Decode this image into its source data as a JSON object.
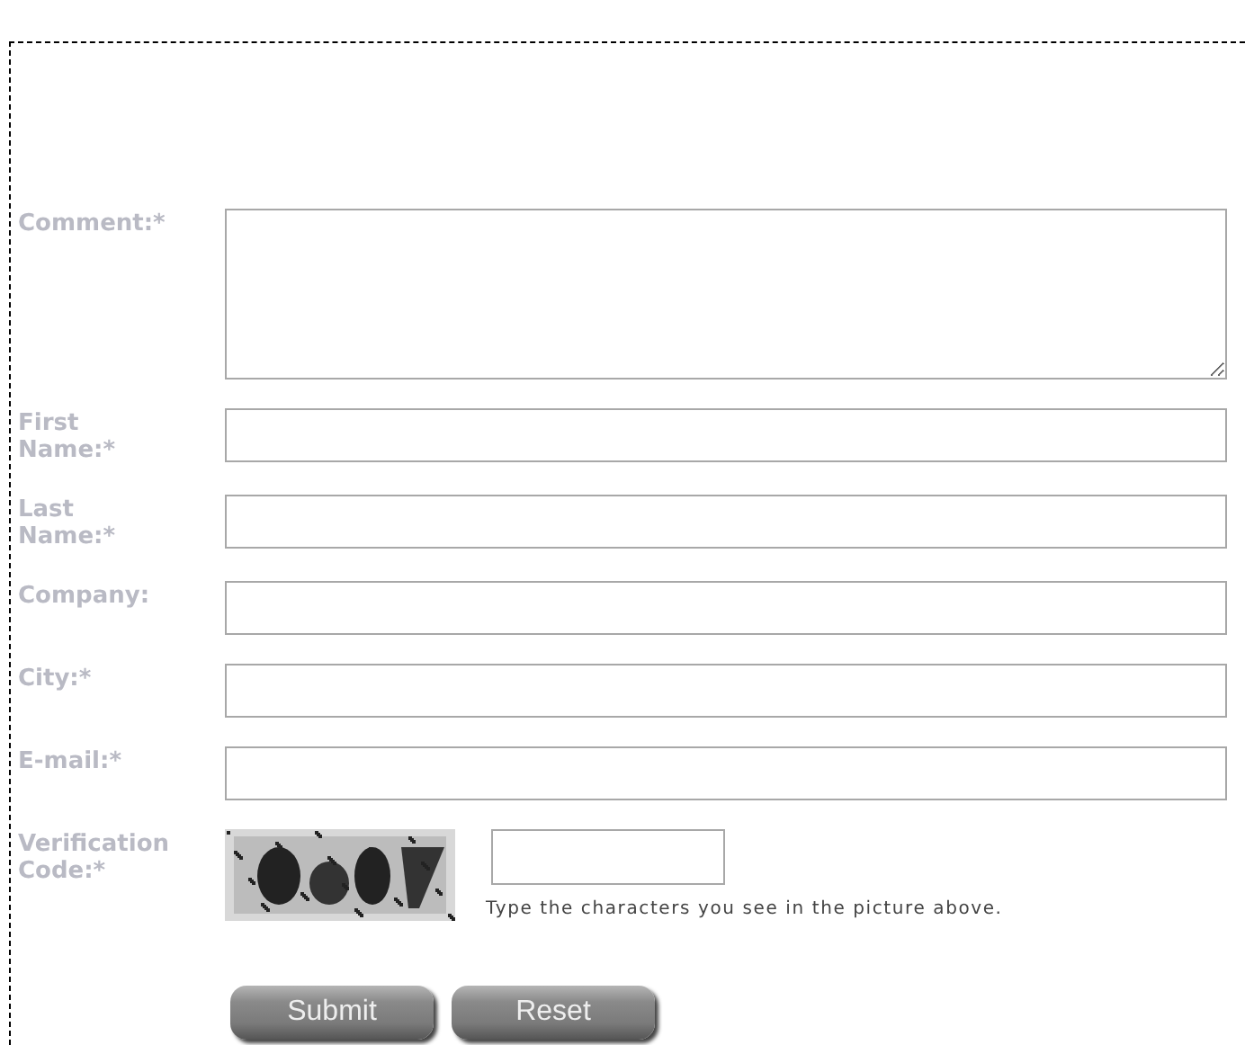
{
  "form": {
    "fields": [
      {
        "label": "Comment:*",
        "kind": "textarea"
      },
      {
        "label": "First Name:*",
        "kind": "text"
      },
      {
        "label": "Last Name:*",
        "kind": "text"
      },
      {
        "label": "Company:",
        "kind": "text"
      },
      {
        "label": "City:*",
        "kind": "text"
      },
      {
        "label": "E-mail:*",
        "kind": "text"
      }
    ],
    "verification": {
      "label": "Verification Code:*",
      "hint": "Type the characters you see in the picture above."
    },
    "buttons": [
      "Submit",
      "Reset"
    ]
  }
}
